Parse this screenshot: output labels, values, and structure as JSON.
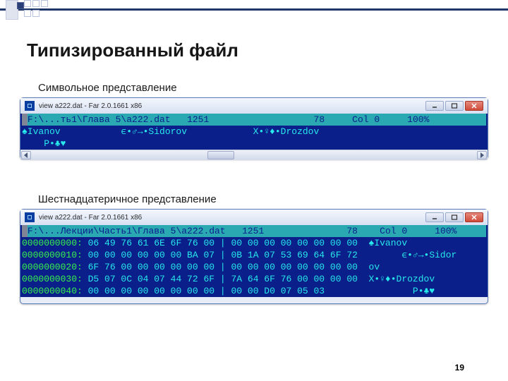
{
  "title": "Типизированный файл",
  "labels": {
    "char": "Символьное представление",
    "hex": "Шестнадцатеричное представление"
  },
  "page_number": "19",
  "colors": {
    "term_bg": "#0a1f8a",
    "term_cyan": "#27e8ea",
    "status_bg": "#2aa9b3",
    "hex_addr": "#37f34b"
  },
  "char_window": {
    "title": "view a222.dat - Far 2.0.1661 x86",
    "status": {
      "path": "F:\\...ть1\\Глава 5\\a222.dat",
      "cp": "1251",
      "pos": "78",
      "col": "Col 0",
      "pct": "100%"
    },
    "rows": [
      "♠Ivanov           ϵ•♂→•Sidorov            X•♀♦•Drozdov",
      "    P•♣♥"
    ]
  },
  "hex_window": {
    "title": "view a222.dat - Far 2.0.1661 x86",
    "status": {
      "path": "F:\\...Лекции\\Часть1\\Глава 5\\a222.dat",
      "cp": "1251",
      "pos": "78",
      "col": "Col 0",
      "pct": "100%"
    },
    "rows": [
      {
        "addr": "0000000000:",
        "l": "06 49 76 61 6E 6F 76 00",
        "r": "00 00 00 00 00 00 00 00",
        "t": "♠Ivanov"
      },
      {
        "addr": "0000000010:",
        "l": "00 00 00 00 00 00 BA 07",
        "r": "0B 1A 07 53 69 64 6F 72",
        "t": "      ϵ•♂→•Sidor"
      },
      {
        "addr": "0000000020:",
        "l": "6F 76 00 00 00 00 00 00",
        "r": "00 00 00 00 00 00 00 00",
        "t": "ov"
      },
      {
        "addr": "0000000030:",
        "l": "D5 07 0C 04 07 44 72 6F",
        "r": "7A 64 6F 76 00 00 00 00",
        "t": "X•♀♦•Drozdov"
      },
      {
        "addr": "0000000040:",
        "l": "00 00 00 00 00 00 00 00",
        "r": "00 00 D0 07 05 03",
        "t": "        P•♣♥"
      }
    ]
  },
  "chart_data": null
}
